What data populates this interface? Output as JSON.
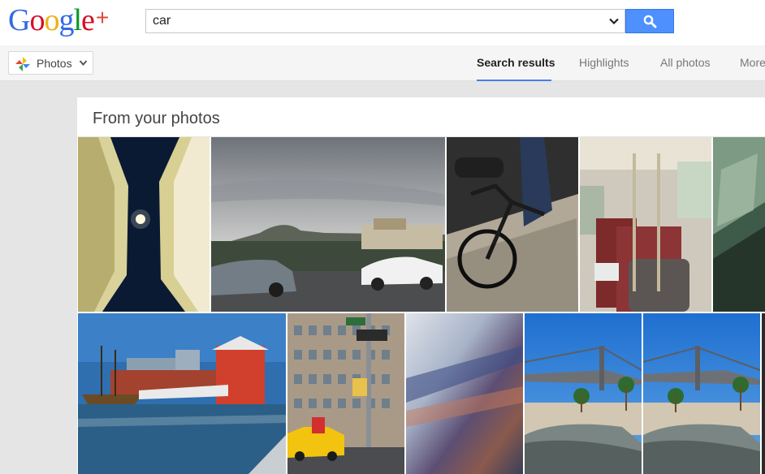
{
  "logo": {
    "letters": [
      "G",
      "o",
      "o",
      "g",
      "l",
      "e"
    ],
    "colors": [
      "#3369e8",
      "#d50f25",
      "#eeb211",
      "#3369e8",
      "#009925",
      "#d50f25"
    ],
    "plus": "+"
  },
  "search": {
    "value": "car",
    "button_icon": "search-icon"
  },
  "app_switcher": {
    "label": "Photos",
    "icon": "pinwheel-icon"
  },
  "tabs": [
    {
      "label": "Search results",
      "active": true
    },
    {
      "label": "Highlights",
      "active": false
    },
    {
      "label": "All photos",
      "active": false
    },
    {
      "label": "More",
      "active": false
    }
  ],
  "results": {
    "section_title": "From your photos",
    "photos": [
      {
        "subject": "tunnel-moon-photo"
      },
      {
        "subject": "coast-cars-photo"
      },
      {
        "subject": "bicycle-photo"
      },
      {
        "subject": "bus-interior-photo"
      },
      {
        "subject": "glass-abstract-photo"
      },
      {
        "subject": "tall-ship-photo"
      },
      {
        "subject": "city-building-taxi-photo"
      },
      {
        "subject": "motion-blur-photo"
      },
      {
        "subject": "bay-bridge-photo-1"
      },
      {
        "subject": "bay-bridge-photo-2"
      }
    ]
  },
  "colors": {
    "accent": "#427fed",
    "search_button": "#4d90fe"
  }
}
